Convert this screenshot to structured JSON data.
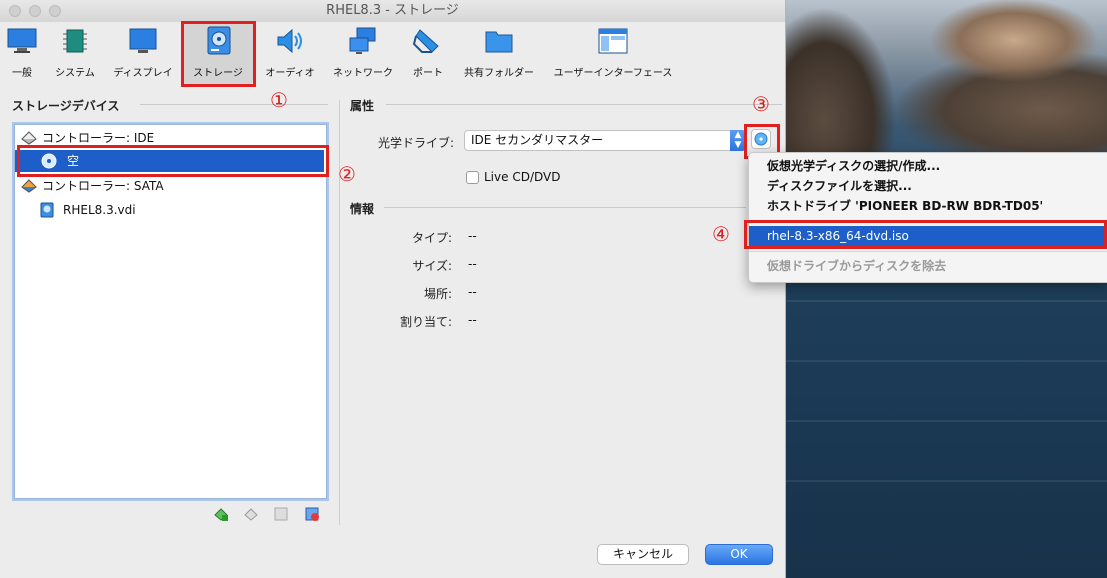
{
  "window": {
    "title": "RHEL8.3 - ストレージ"
  },
  "toolbar": {
    "items": [
      {
        "label": "一般"
      },
      {
        "label": "システム"
      },
      {
        "label": "ディスプレイ"
      },
      {
        "label": "ストレージ"
      },
      {
        "label": "オーディオ"
      },
      {
        "label": "ネットワーク"
      },
      {
        "label": "ポート"
      },
      {
        "label": "共有フォルダー"
      },
      {
        "label": "ユーザーインターフェース"
      }
    ],
    "selected": "ストレージ"
  },
  "storage": {
    "section_title": "ストレージデバイス",
    "tree": [
      {
        "label": "コントローラー: IDE"
      },
      {
        "label": "空"
      },
      {
        "label": "コントローラー: SATA"
      },
      {
        "label": "RHEL8.3.vdi"
      }
    ]
  },
  "attributes": {
    "section_title": "属性",
    "optical_drive_label": "光学ドライブ:",
    "optical_drive_value": "IDE セカンダリマスター",
    "live_cd_label": "Live CD/DVD",
    "live_cd_checked": false
  },
  "info": {
    "section_title": "情報",
    "rows": [
      {
        "label": "タイプ:",
        "value": "--"
      },
      {
        "label": "サイズ:",
        "value": "--"
      },
      {
        "label": "場所:",
        "value": "--"
      },
      {
        "label": "割り当て:",
        "value": "--"
      }
    ]
  },
  "menu": {
    "items": [
      {
        "label": "仮想光学ディスクの選択/作成..."
      },
      {
        "label": "ディスクファイルを選択..."
      },
      {
        "label": "ホストドライブ 'PIONEER BD-RW   BDR-TD05'"
      },
      {
        "label": "rhel-8.3-x86_64-dvd.iso"
      },
      {
        "label": "仮想ドライブからディスクを除去"
      }
    ]
  },
  "annotations": [
    "①",
    "②",
    "③",
    "④"
  ],
  "buttons": {
    "cancel": "キャンセル",
    "ok": "OK"
  },
  "colors": {
    "accent": "#1d5ec8",
    "annotation_red": "#e02020"
  }
}
